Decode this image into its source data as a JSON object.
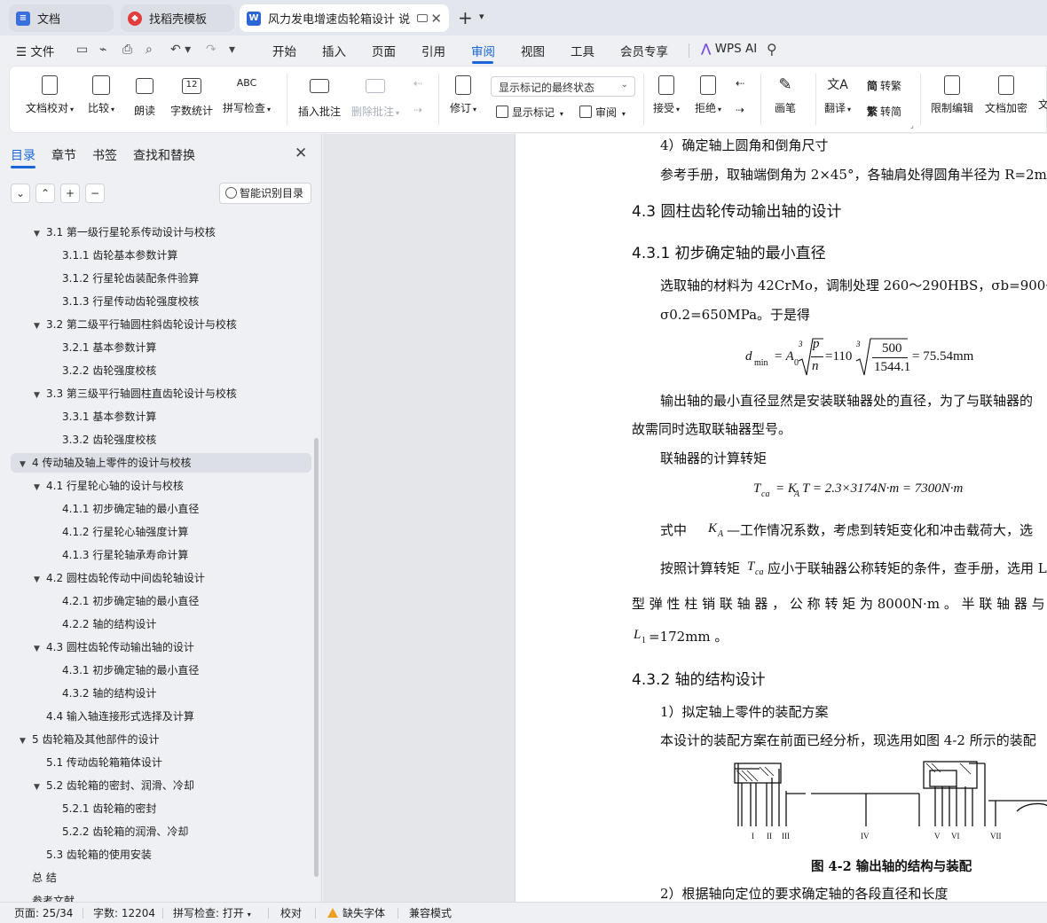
{
  "tabs": [
    {
      "label": "文档",
      "icon": "doc-icon",
      "color": "#3a6fe0"
    },
    {
      "label": "找稻壳模板",
      "icon": "docer-icon",
      "color": "#e23c3c"
    },
    {
      "label": "风力发电增速齿轮箱设计 说明",
      "icon": "wps-writer-icon",
      "color": "#2b66d6"
    }
  ],
  "menu": {
    "file": "文件",
    "items": [
      "开始",
      "插入",
      "页面",
      "引用",
      "审阅",
      "视图",
      "工具",
      "会员专享"
    ],
    "active": "审阅",
    "ai": "WPS AI"
  },
  "ribbon": {
    "doc_check": "文档校对",
    "compare": "比较",
    "read_aloud": "朗读",
    "word_count": "字数统计",
    "spell_check": "拼写检查",
    "insert_comment": "插入批注",
    "delete_comment": "删除批注",
    "revise": "修订",
    "display_state": "显示标记的最终状态",
    "show_markup": "显示标记",
    "review": "审阅",
    "accept": "接受",
    "reject": "拒绝",
    "ink": "画笔",
    "translate": "翻译",
    "to_traditional": "转繁",
    "to_simplified": "转简",
    "restrict_edit": "限制编辑",
    "encrypt": "文档加密",
    "more_partial": "文"
  },
  "panel": {
    "tabs": [
      "目录",
      "章节",
      "书签",
      "查找和替换"
    ],
    "smart_toc": "智能识别目录",
    "toc": [
      {
        "text": "3.1 第一级行星轮系传动设计与校核",
        "level": 2,
        "expanded": true
      },
      {
        "text": "3.1.1 齿轮基本参数计算",
        "level": 3
      },
      {
        "text": "3.1.2 行星轮齿装配条件验算",
        "level": 3
      },
      {
        "text": "3.1.3 行星传动齿轮强度校核",
        "level": 3
      },
      {
        "text": "3.2 第二级平行轴圆柱斜齿轮设计与校核",
        "level": 2,
        "expanded": true
      },
      {
        "text": "3.2.1 基本参数计算",
        "level": 3
      },
      {
        "text": "3.2.2 齿轮强度校核",
        "level": 3
      },
      {
        "text": "3.3 第三级平行轴圆柱直齿轮设计与校核",
        "level": 2,
        "expanded": true
      },
      {
        "text": "3.3.1 基本参数计算",
        "level": 3
      },
      {
        "text": "3.3.2 齿轮强度校核",
        "level": 3
      },
      {
        "text": "4 传动轴及轴上零件的设计与校核",
        "level": 1,
        "expanded": true,
        "selected": true
      },
      {
        "text": "4.1 行星轮心轴的设计与校核",
        "level": 2,
        "expanded": true
      },
      {
        "text": "4.1.1 初步确定轴的最小直径",
        "level": 3
      },
      {
        "text": "4.1.2 行星轮心轴强度计算",
        "level": 3
      },
      {
        "text": "4.1.3 行星轮轴承寿命计算",
        "level": 3
      },
      {
        "text": "4.2 圆柱齿轮传动中间齿轮轴设计",
        "level": 2,
        "expanded": true
      },
      {
        "text": "4.2.1 初步确定轴的最小直径",
        "level": 3
      },
      {
        "text": "4.2.2 轴的结构设计",
        "level": 3
      },
      {
        "text": "4.3 圆柱齿轮传动输出轴的设计",
        "level": 2,
        "expanded": true
      },
      {
        "text": "4.3.1 初步确定轴的最小直径",
        "level": 3
      },
      {
        "text": "4.3.2 轴的结构设计",
        "level": 3
      },
      {
        "text": "4.4 输入轴连接形式选择及计算",
        "level": 2
      },
      {
        "text": "5  齿轮箱及其他部件的设计",
        "level": 1,
        "expanded": true
      },
      {
        "text": "5.1 传动齿轮箱箱体设计",
        "level": 2
      },
      {
        "text": "5.2 齿轮箱的密封、润滑、冷却",
        "level": 2,
        "expanded": true
      },
      {
        "text": "5.2.1 齿轮箱的密封",
        "level": 3
      },
      {
        "text": "5.2.2 齿轮箱的润滑、冷却",
        "level": 3
      },
      {
        "text": "5.3 齿轮箱的使用安装",
        "level": 2
      },
      {
        "text": "总  结",
        "level": 1
      },
      {
        "text": "参考文献",
        "level": 1
      }
    ]
  },
  "doc": {
    "l1": "4）确定轴上圆角和倒角尺寸",
    "l2": "参考手册，取轴端倒角为 2×45°，各轴肩处得圆角半径为 R=2m",
    "h1": "4.3 圆柱齿轮传动输出轴的设计",
    "h2": "4.3.1 初步确定轴的最小直径",
    "p1": "选取轴的材料为 42CrMo，调制处理 260～290HBS，σb=900～1",
    "p2": "σ0.2=650MPa。于是得",
    "eq1": "dmin = A0 ∛(p/n) = 110 ∛(500/1544.1) = 75.54mm",
    "eq1_lhs": "d",
    "eq1_lhs_sub": "min",
    "eq1_a": "= A",
    "eq1_a_sub": "0",
    "eq1_p": "p",
    "eq1_n": "n",
    "eq1_mid": "=110",
    "eq1_num": "500",
    "eq1_den": "1544.1",
    "eq1_res": "= 75.54mm",
    "p3": "输出轴的最小直径显然是安装联轴器处的直径，为了与联轴器的",
    "p4": "故需同时选取联轴器型号。",
    "p5": "联轴器的计算转矩",
    "eq2": "Tca = KA T = 2.3×3174N·m = 7300N·m",
    "eq2_t": "T",
    "eq2_t_sub": "ca",
    "eq2_k": "= K",
    "eq2_k_sub": "A",
    "eq2_rest": "T = 2.3×3174N·m = 7300N·m",
    "p6_a": "式中",
    "p6_k": "K",
    "p6_k_sub": "A",
    "p6_b": "—工作情况系数，考虑到转矩变化和冲击载荷大，选",
    "p7_a": "按照计算转矩",
    "p7_t": "T",
    "p7_t_sub": "ca",
    "p7_b": "应小于联轴器公称转矩的条件，查手册，选用 L",
    "p8": "型 弹 性 柱 销 联 轴 器 ， 公 称 转 矩 为  8000N·m 。 半 联 轴 器 与 轴 配",
    "p9_l": "L",
    "p9_sub": "1",
    "p9_rest": "=172mm 。",
    "h3": "4.3.2 轴的结构设计",
    "p10": "1）拟定轴上零件的装配方案",
    "p11": "本设计的装配方案在前面已经分析，现选用如图 4-2 所示的装配",
    "fig_labels": [
      "I",
      "II",
      "III",
      "IV",
      "V",
      "VI",
      "VII"
    ],
    "caption": "图 4-2  输出轴的结构与装配",
    "p12": "2）根据轴向定位的要求确定轴的各段直径和长度"
  },
  "status": {
    "page": "页面: 25/34",
    "words": "字数: 12204",
    "spell": "拼写检查: 打开",
    "proof": "校对",
    "missing_font": "缺失字体",
    "compat": "兼容模式"
  }
}
